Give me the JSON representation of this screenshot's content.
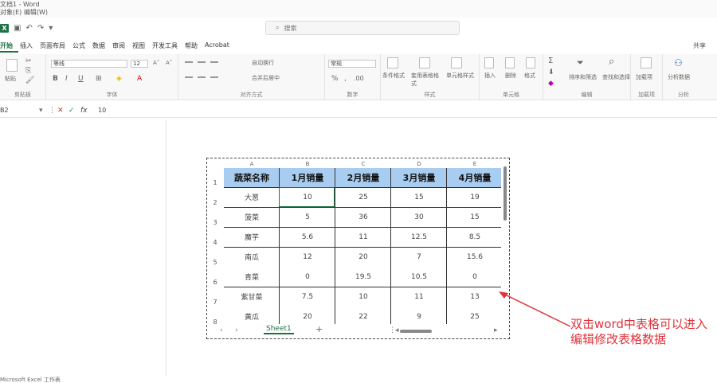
{
  "window": {
    "title": "文档1 - Word",
    "menu": "对象(E)  编辑(W)"
  },
  "quick_access": {
    "logo": "X",
    "undo": "↶",
    "redo": "↷",
    "more": "▾"
  },
  "search": {
    "placeholder": "搜索"
  },
  "tabs": [
    {
      "label": "开始",
      "active": true
    },
    {
      "label": "插入",
      "active": false
    },
    {
      "label": "页面布局",
      "active": false
    },
    {
      "label": "公式",
      "active": false
    },
    {
      "label": "数据",
      "active": false
    },
    {
      "label": "审阅",
      "active": false
    },
    {
      "label": "视图",
      "active": false
    },
    {
      "label": "开发工具",
      "active": false
    },
    {
      "label": "帮助",
      "active": false
    },
    {
      "label": "Acrobat",
      "active": false
    }
  ],
  "share": "共享",
  "ribbon": {
    "clipboard": {
      "label": "剪贴板",
      "paste": "粘贴"
    },
    "font": {
      "label": "字体",
      "family": "等线",
      "size": "12",
      "grow": "A˄",
      "shrink": "A˅",
      "bold": "B",
      "italic": "I",
      "underline": "U"
    },
    "alignment": {
      "label": "对齐方式",
      "wrap": "自动换行",
      "merge": "合并后居中"
    },
    "number": {
      "label": "数字",
      "format": "常规",
      "percent": "%"
    },
    "styles": {
      "label": "样式",
      "conditional": "条件格式",
      "table": "套用表格格式",
      "cell": "单元格样式"
    },
    "cells": {
      "label": "单元格",
      "insert": "插入",
      "delete": "删除",
      "format": "格式"
    },
    "editing": {
      "label": "编辑",
      "sort": "排序和筛选",
      "find": "查找和选择"
    },
    "ideas": {
      "label": "加载项",
      "btn": "加载项"
    },
    "analysis": {
      "label": "分析",
      "btn": "分析数据"
    }
  },
  "formula_bar": {
    "name": "B2",
    "cancel": "✕",
    "enter": "✓",
    "fx": "fx",
    "value": "10"
  },
  "sheet": {
    "col_letters": [
      "A",
      "B",
      "C",
      "D",
      "E"
    ],
    "row_numbers": [
      "1",
      "2",
      "3",
      "4",
      "5",
      "6",
      "7",
      "8"
    ],
    "headers": [
      "蔬菜名称",
      "1月销量",
      "2月销量",
      "3月销量",
      "4月销量"
    ],
    "rows": [
      [
        "大葱",
        "10",
        "25",
        "15",
        "19"
      ],
      [
        "菠菜",
        "5",
        "36",
        "30",
        "15"
      ],
      [
        "魔芋",
        "5.6",
        "11",
        "12.5",
        "8.5"
      ],
      [
        "南瓜",
        "12",
        "20",
        "7",
        "15.6"
      ],
      [
        "青菜",
        "0",
        "19.5",
        "10.5",
        "0"
      ],
      [
        "紫甘菜",
        "7.5",
        "10",
        "11",
        "13"
      ],
      [
        "黄瓜",
        "20",
        "22",
        "9",
        "25"
      ]
    ],
    "tab_name": "Sheet1",
    "add_sheet": "+",
    "nav_prev": "‹",
    "nav_next": "›"
  },
  "annotation": {
    "text": "双击word中表格可以进入编辑修改表格数据",
    "color": "#e0323a"
  },
  "status": {
    "text": "Microsoft Excel 工作表"
  },
  "colors": {
    "accent": "#1e7145",
    "header_fill": "#a9cdf0"
  }
}
